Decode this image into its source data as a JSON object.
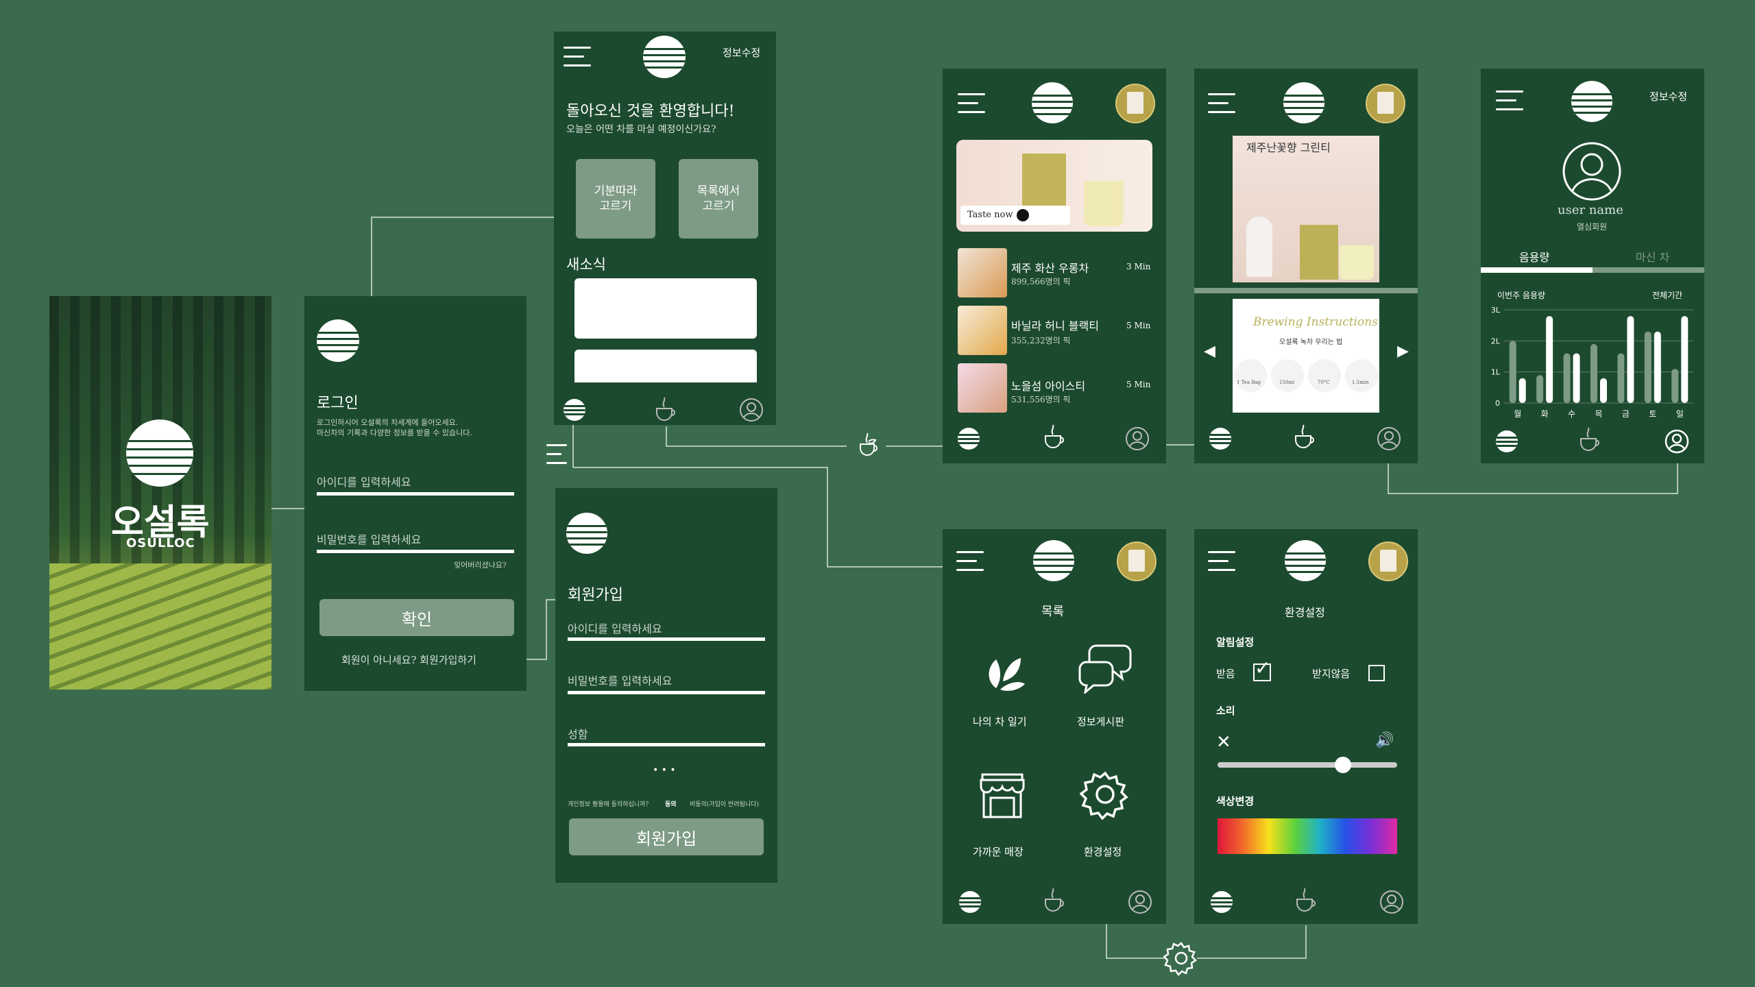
{
  "splash": {
    "brand_ko": "오설록",
    "brand_en": "OSULLOC"
  },
  "login": {
    "title": "로그인",
    "desc_line1": "로그인하시어 오설록의 차세계에 들어오세요.",
    "desc_line2": "마신차의 기록과 다양한 정보를 받을 수 있습니다.",
    "id_placeholder": "아이디를 입력하세요",
    "pw_placeholder": "비밀번호를 입력하세요",
    "forgot": "잊어버리셨나요?",
    "confirm": "확인",
    "signup_prompt": "회원이 아니세요? 회원가입하기"
  },
  "home": {
    "edit": "정보수정",
    "welcome": "돌아오신 것을 환영합니다!",
    "question": "오늘은 어떤 차를 마실 예정이신가요?",
    "mood_btn_1": "기분따라",
    "mood_btn_2": "고르기",
    "list_btn_1": "목록에서",
    "list_btn_2": "고르기",
    "news": "새소식"
  },
  "signup": {
    "title": "회원가입",
    "id_placeholder": "아이디를 입력하세요",
    "pw_placeholder": "비밀번호를 입력하세요",
    "name_placeholder": "성함",
    "more": "• • •",
    "consent_q": "개인정보 활용에 동의하십니까?",
    "consent_yes": "동의",
    "consent_no": "비동의(가입이 반려됩니다)",
    "button": "회원가입"
  },
  "tealist": {
    "taste_now": "Taste now",
    "items": [
      {
        "name": "제주 화산 우롱차",
        "count": "899,566명의 픽",
        "time": "3 Min"
      },
      {
        "name": "바닐라 허니 블랙티",
        "count": "355,232명의 픽",
        "time": "5 Min"
      },
      {
        "name": "노을섬 아이스티",
        "count": "531,556명의 픽",
        "time": "5 Min"
      }
    ]
  },
  "detail": {
    "product": "제주난꽃향 그린티",
    "brewing_title": "Brewing Instructions",
    "brewing_sub": "오설록 녹차 우리는 법",
    "steps": [
      "1 Tea Bag",
      "150ml",
      "70°C",
      "1.5min"
    ]
  },
  "profile": {
    "edit": "정보수정",
    "username": "user name",
    "member": "열심회원",
    "tab_active": "음용량",
    "tab_inactive": "마신 차",
    "period_label": "이번주 음용량",
    "period_all": "전체기간"
  },
  "chart_data": {
    "type": "bar",
    "categories": [
      "월",
      "화",
      "수",
      "목",
      "금",
      "토",
      "일"
    ],
    "y_ticks": [
      "0",
      "1L",
      "2L",
      "3L"
    ],
    "ylim": [
      0,
      3
    ],
    "series": [
      {
        "values": [
          2.0,
          0.9,
          1.6,
          1.9,
          1.6,
          2.3,
          1.1
        ]
      },
      {
        "values": [
          0.8,
          2.8,
          1.6,
          0.8,
          2.8,
          2.3,
          2.8
        ]
      }
    ],
    "colors": [
      "#7e9b85",
      "#ffffff"
    ],
    "grid": true
  },
  "menu": {
    "title": "목록",
    "items": [
      "나의 차 일기",
      "정보게시판",
      "가까운 매장",
      "환경설정"
    ]
  },
  "settings": {
    "title": "환경설정",
    "notif": "알림설정",
    "receive": "받음",
    "not_receive": "받지않음",
    "sound": "소리",
    "color": "색상변경",
    "volume": 0.7
  },
  "colors": {
    "background": "#3a6b4d",
    "panel": "#1c4a2e",
    "button": "#7e9b85"
  }
}
